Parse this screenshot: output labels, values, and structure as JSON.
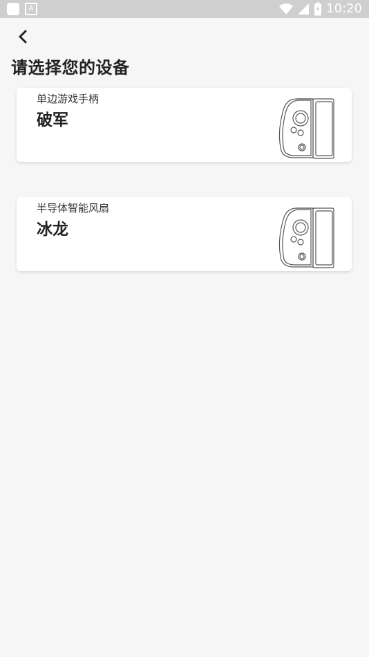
{
  "status_bar": {
    "time": "10:20",
    "left_icons": [
      "app-square-icon",
      "a-icon"
    ],
    "right_icons": [
      "wifi-icon",
      "signal-icon",
      "battery-icon"
    ]
  },
  "header": {
    "back_icon": "chevron-left-icon",
    "title": "请选择您的设备"
  },
  "devices": [
    {
      "subtitle": "单边游戏手柄",
      "name": "破军",
      "image": "gamepad-icon"
    },
    {
      "subtitle": "半导体智能风扇",
      "name": "冰龙",
      "image": "gamepad-icon"
    }
  ],
  "colors": {
    "background": "#f6f6f6",
    "status_bar": "#cfcfcf",
    "card": "#ffffff",
    "text": "#222222"
  }
}
